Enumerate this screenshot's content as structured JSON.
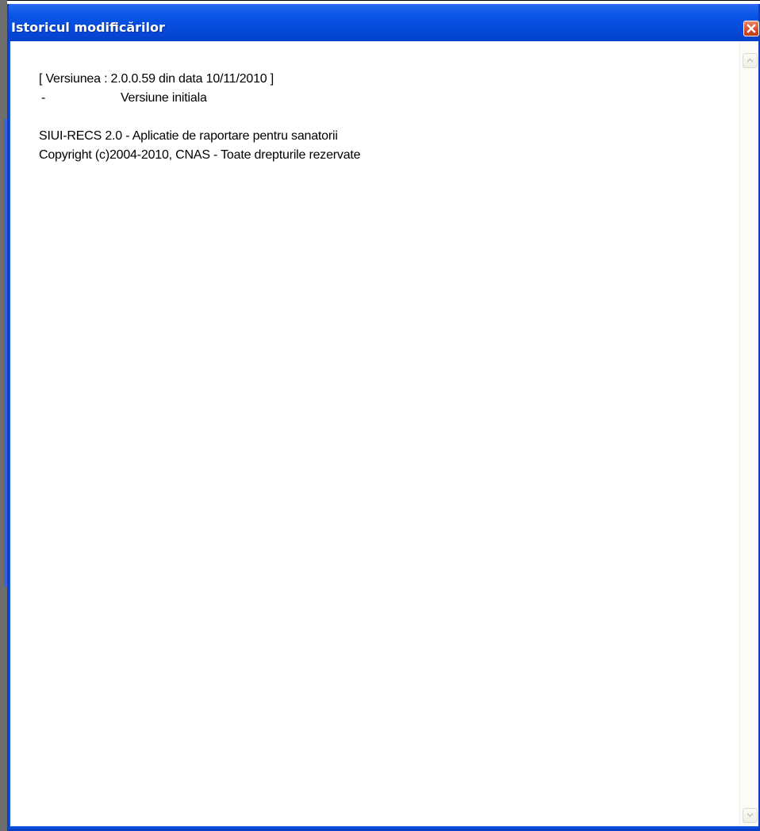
{
  "window": {
    "title": "Istoricul modificărilor"
  },
  "content": {
    "lines": [
      {
        "text": "[ Versiunea : 2.0.0.59 din data 10/11/2010 ]"
      },
      {
        "bullet": "-",
        "text": "Versiune initiala"
      },
      {
        "text": ""
      },
      {
        "text": "SIUI-RECS 2.0 - Aplicatie de raportare pentru sanatorii"
      },
      {
        "text": "Copyright (c)2004-2010, CNAS - Toate drepturile rezervate"
      }
    ]
  },
  "icons": {
    "close": "close-icon",
    "scroll_up": "scroll-up-arrow-icon",
    "scroll_down": "scroll-down-arrow-icon"
  },
  "colors": {
    "titlebar": "#0a55e6",
    "close_button": "#d8502c",
    "background": "#ffffff",
    "text": "#000000"
  }
}
